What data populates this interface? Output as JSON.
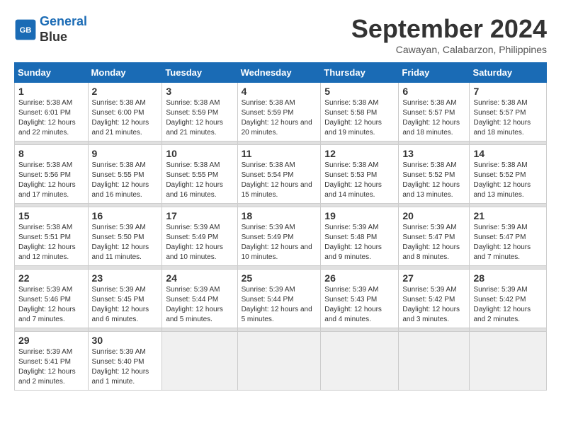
{
  "logo": {
    "line1": "General",
    "line2": "Blue"
  },
  "title": "September 2024",
  "subtitle": "Cawayan, Calabarzon, Philippines",
  "days_header": [
    "Sunday",
    "Monday",
    "Tuesday",
    "Wednesday",
    "Thursday",
    "Friday",
    "Saturday"
  ],
  "weeks": [
    [
      {
        "num": "1",
        "sunrise": "5:38 AM",
        "sunset": "6:01 PM",
        "daylight": "12 hours and 22 minutes."
      },
      {
        "num": "2",
        "sunrise": "5:38 AM",
        "sunset": "6:00 PM",
        "daylight": "12 hours and 21 minutes."
      },
      {
        "num": "3",
        "sunrise": "5:38 AM",
        "sunset": "5:59 PM",
        "daylight": "12 hours and 21 minutes."
      },
      {
        "num": "4",
        "sunrise": "5:38 AM",
        "sunset": "5:59 PM",
        "daylight": "12 hours and 20 minutes."
      },
      {
        "num": "5",
        "sunrise": "5:38 AM",
        "sunset": "5:58 PM",
        "daylight": "12 hours and 19 minutes."
      },
      {
        "num": "6",
        "sunrise": "5:38 AM",
        "sunset": "5:57 PM",
        "daylight": "12 hours and 18 minutes."
      },
      {
        "num": "7",
        "sunrise": "5:38 AM",
        "sunset": "5:57 PM",
        "daylight": "12 hours and 18 minutes."
      }
    ],
    [
      {
        "num": "8",
        "sunrise": "5:38 AM",
        "sunset": "5:56 PM",
        "daylight": "12 hours and 17 minutes."
      },
      {
        "num": "9",
        "sunrise": "5:38 AM",
        "sunset": "5:55 PM",
        "daylight": "12 hours and 16 minutes."
      },
      {
        "num": "10",
        "sunrise": "5:38 AM",
        "sunset": "5:55 PM",
        "daylight": "12 hours and 16 minutes."
      },
      {
        "num": "11",
        "sunrise": "5:38 AM",
        "sunset": "5:54 PM",
        "daylight": "12 hours and 15 minutes."
      },
      {
        "num": "12",
        "sunrise": "5:38 AM",
        "sunset": "5:53 PM",
        "daylight": "12 hours and 14 minutes."
      },
      {
        "num": "13",
        "sunrise": "5:38 AM",
        "sunset": "5:52 PM",
        "daylight": "12 hours and 13 minutes."
      },
      {
        "num": "14",
        "sunrise": "5:38 AM",
        "sunset": "5:52 PM",
        "daylight": "12 hours and 13 minutes."
      }
    ],
    [
      {
        "num": "15",
        "sunrise": "5:38 AM",
        "sunset": "5:51 PM",
        "daylight": "12 hours and 12 minutes."
      },
      {
        "num": "16",
        "sunrise": "5:39 AM",
        "sunset": "5:50 PM",
        "daylight": "12 hours and 11 minutes."
      },
      {
        "num": "17",
        "sunrise": "5:39 AM",
        "sunset": "5:49 PM",
        "daylight": "12 hours and 10 minutes."
      },
      {
        "num": "18",
        "sunrise": "5:39 AM",
        "sunset": "5:49 PM",
        "daylight": "12 hours and 10 minutes."
      },
      {
        "num": "19",
        "sunrise": "5:39 AM",
        "sunset": "5:48 PM",
        "daylight": "12 hours and 9 minutes."
      },
      {
        "num": "20",
        "sunrise": "5:39 AM",
        "sunset": "5:47 PM",
        "daylight": "12 hours and 8 minutes."
      },
      {
        "num": "21",
        "sunrise": "5:39 AM",
        "sunset": "5:47 PM",
        "daylight": "12 hours and 7 minutes."
      }
    ],
    [
      {
        "num": "22",
        "sunrise": "5:39 AM",
        "sunset": "5:46 PM",
        "daylight": "12 hours and 7 minutes."
      },
      {
        "num": "23",
        "sunrise": "5:39 AM",
        "sunset": "5:45 PM",
        "daylight": "12 hours and 6 minutes."
      },
      {
        "num": "24",
        "sunrise": "5:39 AM",
        "sunset": "5:44 PM",
        "daylight": "12 hours and 5 minutes."
      },
      {
        "num": "25",
        "sunrise": "5:39 AM",
        "sunset": "5:44 PM",
        "daylight": "12 hours and 5 minutes."
      },
      {
        "num": "26",
        "sunrise": "5:39 AM",
        "sunset": "5:43 PM",
        "daylight": "12 hours and 4 minutes."
      },
      {
        "num": "27",
        "sunrise": "5:39 AM",
        "sunset": "5:42 PM",
        "daylight": "12 hours and 3 minutes."
      },
      {
        "num": "28",
        "sunrise": "5:39 AM",
        "sunset": "5:42 PM",
        "daylight": "12 hours and 2 minutes."
      }
    ],
    [
      {
        "num": "29",
        "sunrise": "5:39 AM",
        "sunset": "5:41 PM",
        "daylight": "12 hours and 2 minutes."
      },
      {
        "num": "30",
        "sunrise": "5:39 AM",
        "sunset": "5:40 PM",
        "daylight": "12 hours and 1 minute."
      },
      null,
      null,
      null,
      null,
      null
    ]
  ]
}
